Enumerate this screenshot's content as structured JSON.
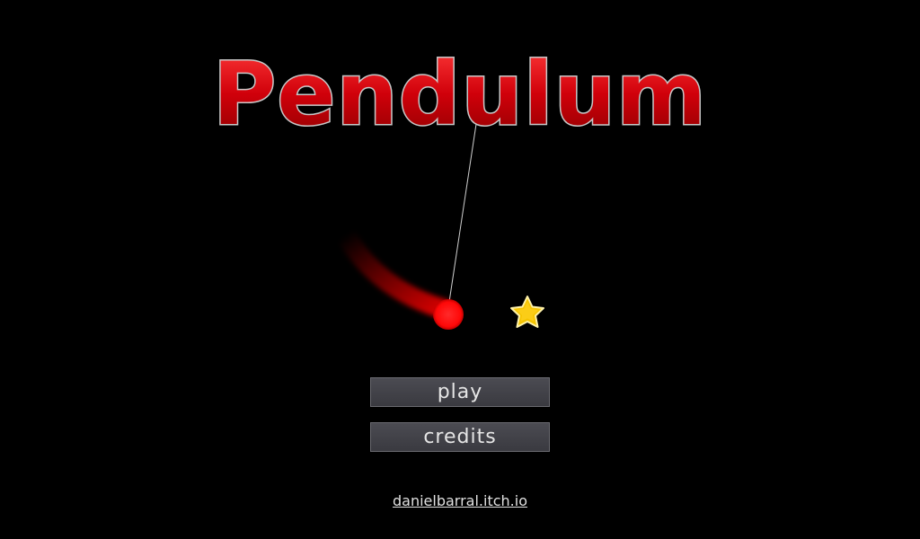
{
  "game": {
    "title": "Pendulum",
    "colors": {
      "background": "#000000",
      "title_fill": "#d0000a",
      "title_outline": "#c8c8c8",
      "ball": "#ff1010",
      "star": "#f5c400"
    }
  },
  "menu": {
    "play_label": "play",
    "credits_label": "credits"
  },
  "footer": {
    "link_text": "danielbarral.itch.io"
  },
  "icons": {
    "star": "star-icon"
  }
}
